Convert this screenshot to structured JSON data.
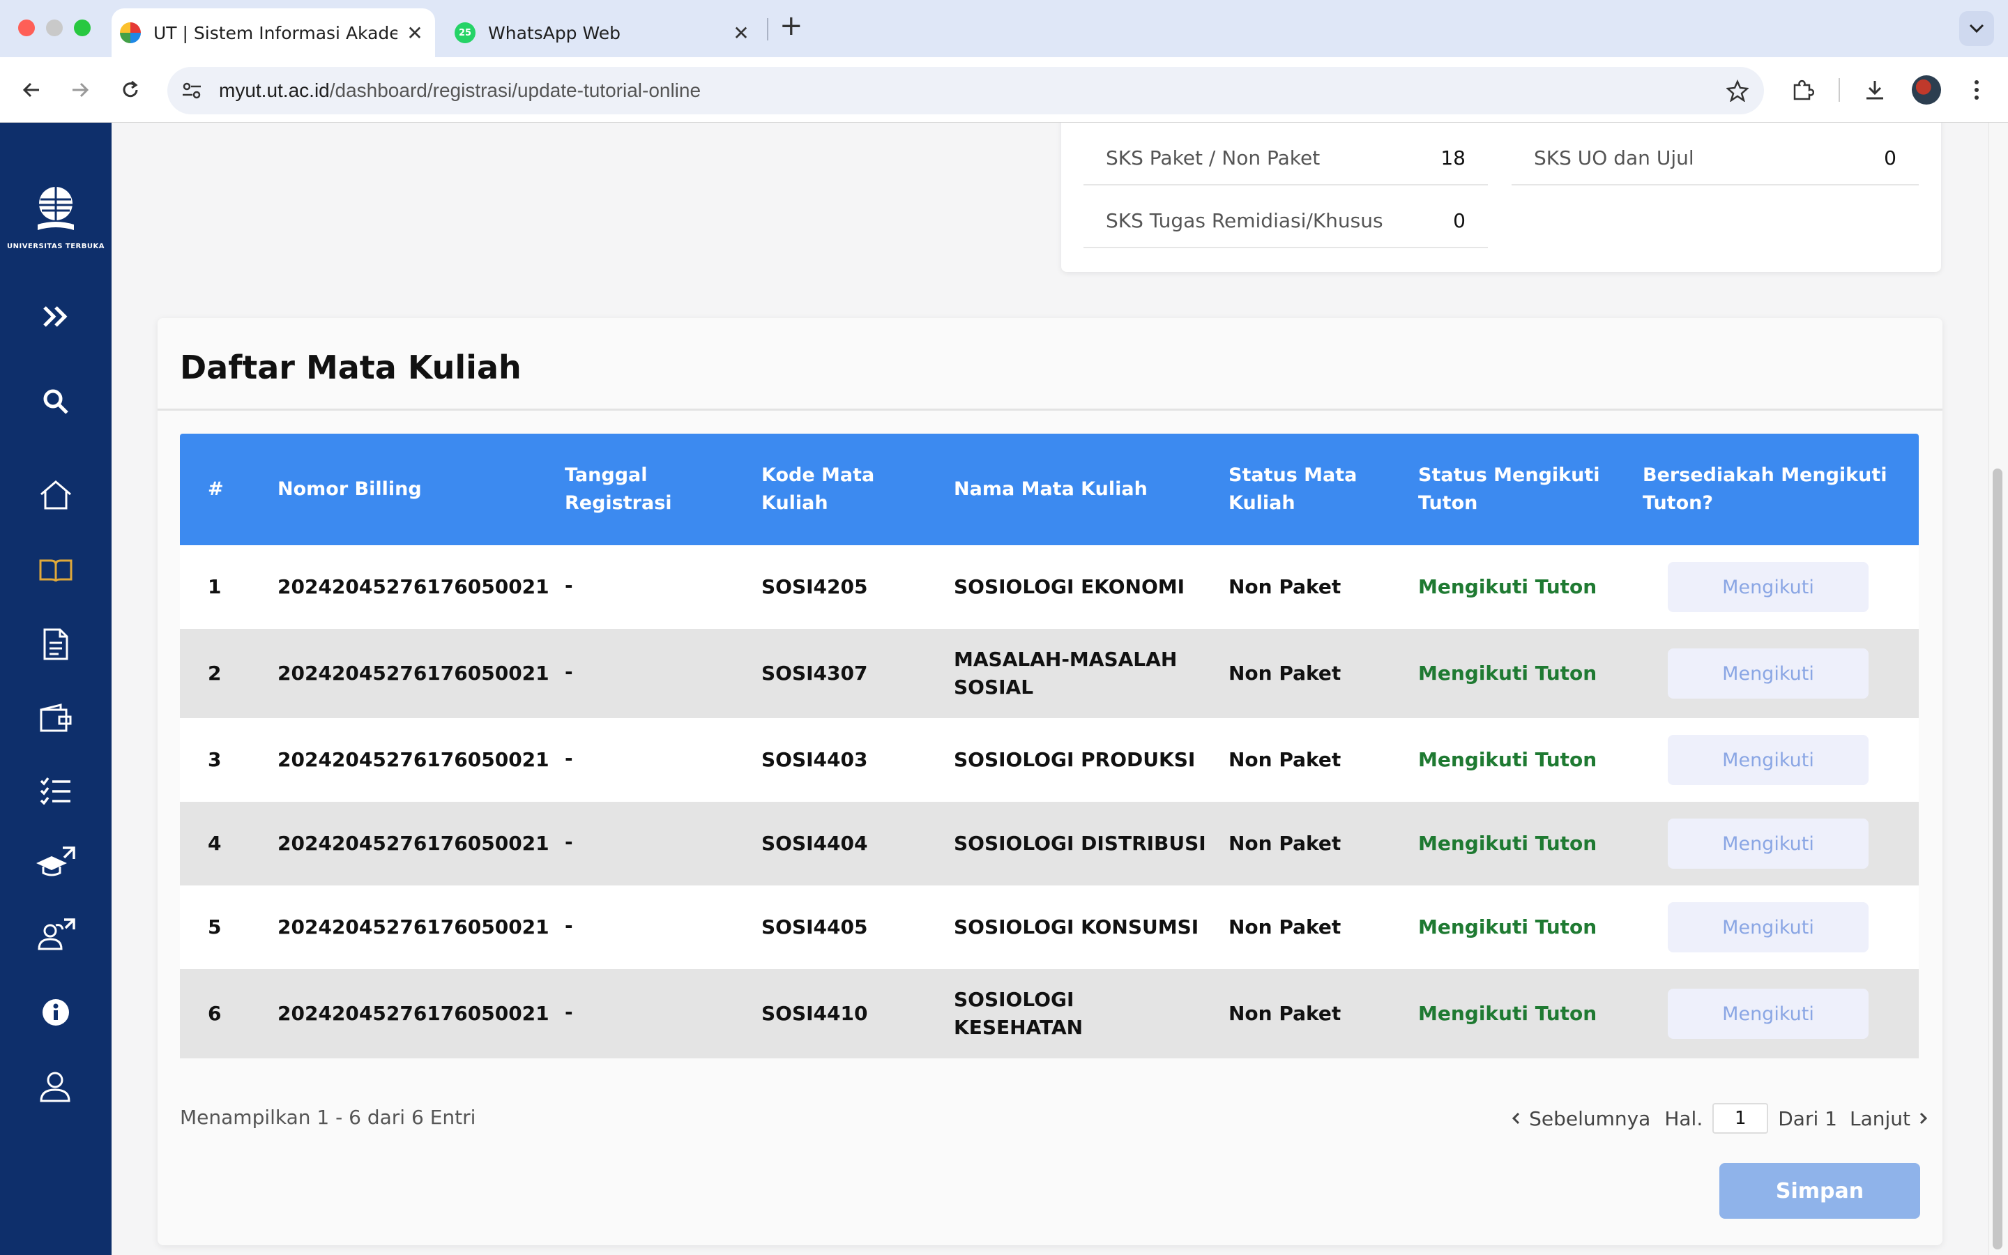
{
  "browser": {
    "tabs": [
      {
        "title": "UT | Sistem Informasi Akadem",
        "active": true
      },
      {
        "title": "WhatsApp Web",
        "active": false
      }
    ],
    "whatsapp_badge": "25",
    "url_domain": "myut.ut.ac.id",
    "url_path": "/dashboard/registrasi/update-tutorial-online"
  },
  "sidebar": {
    "logo_text": "UNIVERSITAS TERBUKA",
    "items": [
      {
        "name": "expand",
        "icon": "double-chevron-right-icon"
      },
      {
        "name": "search",
        "icon": "search-icon"
      },
      {
        "name": "home",
        "icon": "home-icon"
      },
      {
        "name": "courses",
        "icon": "book-icon",
        "active": true
      },
      {
        "name": "documents",
        "icon": "document-icon"
      },
      {
        "name": "wallet",
        "icon": "wallet-icon"
      },
      {
        "name": "checklist",
        "icon": "checklist-icon"
      },
      {
        "name": "graduation-external",
        "icon": "graduation-cap-external-icon"
      },
      {
        "name": "users-external",
        "icon": "users-external-icon"
      },
      {
        "name": "info",
        "icon": "info-icon"
      },
      {
        "name": "profile",
        "icon": "user-icon"
      }
    ]
  },
  "sks": {
    "paket_label": "SKS Paket / Non Paket",
    "paket_value": "18",
    "uo_label": "SKS UO dan Ujul",
    "uo_value": "0",
    "remidiasi_label": "SKS Tugas Remidiasi/Khusus",
    "remidiasi_value": "0"
  },
  "course_list": {
    "title": "Daftar Mata Kuliah",
    "headers": {
      "no": "#",
      "billing": "Nomor Billing",
      "tanggal_1": "Tanggal",
      "tanggal_2": "Registrasi",
      "kode_1": "Kode Mata",
      "kode_2": "Kuliah",
      "nama": "Nama Mata Kuliah",
      "status_mk_1": "Status Mata",
      "status_mk_2": "Kuliah",
      "status_tuton_1": "Status Mengikuti",
      "status_tuton_2": "Tuton",
      "bersedia_1": "Bersediakah Mengikuti",
      "bersedia_2": "Tuton?"
    },
    "rows": [
      {
        "no": "1",
        "billing": "20242045276176050021",
        "tanggal": "-",
        "kode": "SOSI4205",
        "nama_1": "SOSIOLOGI EKONOMI",
        "nama_2": "",
        "status_mk": "Non Paket",
        "status_tuton": "Mengikuti Tuton",
        "action": "Mengikuti"
      },
      {
        "no": "2",
        "billing": "20242045276176050021",
        "tanggal": "-",
        "kode": "SOSI4307",
        "nama_1": "MASALAH-MASALAH",
        "nama_2": "SOSIAL",
        "status_mk": "Non Paket",
        "status_tuton": "Mengikuti Tuton",
        "action": "Mengikuti"
      },
      {
        "no": "3",
        "billing": "20242045276176050021",
        "tanggal": "-",
        "kode": "SOSI4403",
        "nama_1": "SOSIOLOGI PRODUKSI",
        "nama_2": "",
        "status_mk": "Non Paket",
        "status_tuton": "Mengikuti Tuton",
        "action": "Mengikuti"
      },
      {
        "no": "4",
        "billing": "20242045276176050021",
        "tanggal": "-",
        "kode": "SOSI4404",
        "nama_1": "SOSIOLOGI DISTRIBUSI",
        "nama_2": "",
        "status_mk": "Non Paket",
        "status_tuton": "Mengikuti Tuton",
        "action": "Mengikuti"
      },
      {
        "no": "5",
        "billing": "20242045276176050021",
        "tanggal": "-",
        "kode": "SOSI4405",
        "nama_1": "SOSIOLOGI KONSUMSI",
        "nama_2": "",
        "status_mk": "Non Paket",
        "status_tuton": "Mengikuti Tuton",
        "action": "Mengikuti"
      },
      {
        "no": "6",
        "billing": "20242045276176050021",
        "tanggal": "-",
        "kode": "SOSI4410",
        "nama_1": "SOSIOLOGI",
        "nama_2": "KESEHATAN",
        "status_mk": "Non Paket",
        "status_tuton": "Mengikuti Tuton",
        "action": "Mengikuti"
      }
    ],
    "footer_info": "Menampilkan 1 - 6 dari 6 Entri",
    "pager": {
      "prev": "Sebelumnya",
      "page_label": "Hal.",
      "page_value": "1",
      "of": "Dari 1",
      "next": "Lanjut"
    },
    "save": "Simpan"
  },
  "colors": {
    "sidebar": "#0e2f6b",
    "table_header": "#3c8af0",
    "status_green": "#1f7a32",
    "active_icon": "#e0a93a",
    "save_button": "#8fb3ea"
  }
}
